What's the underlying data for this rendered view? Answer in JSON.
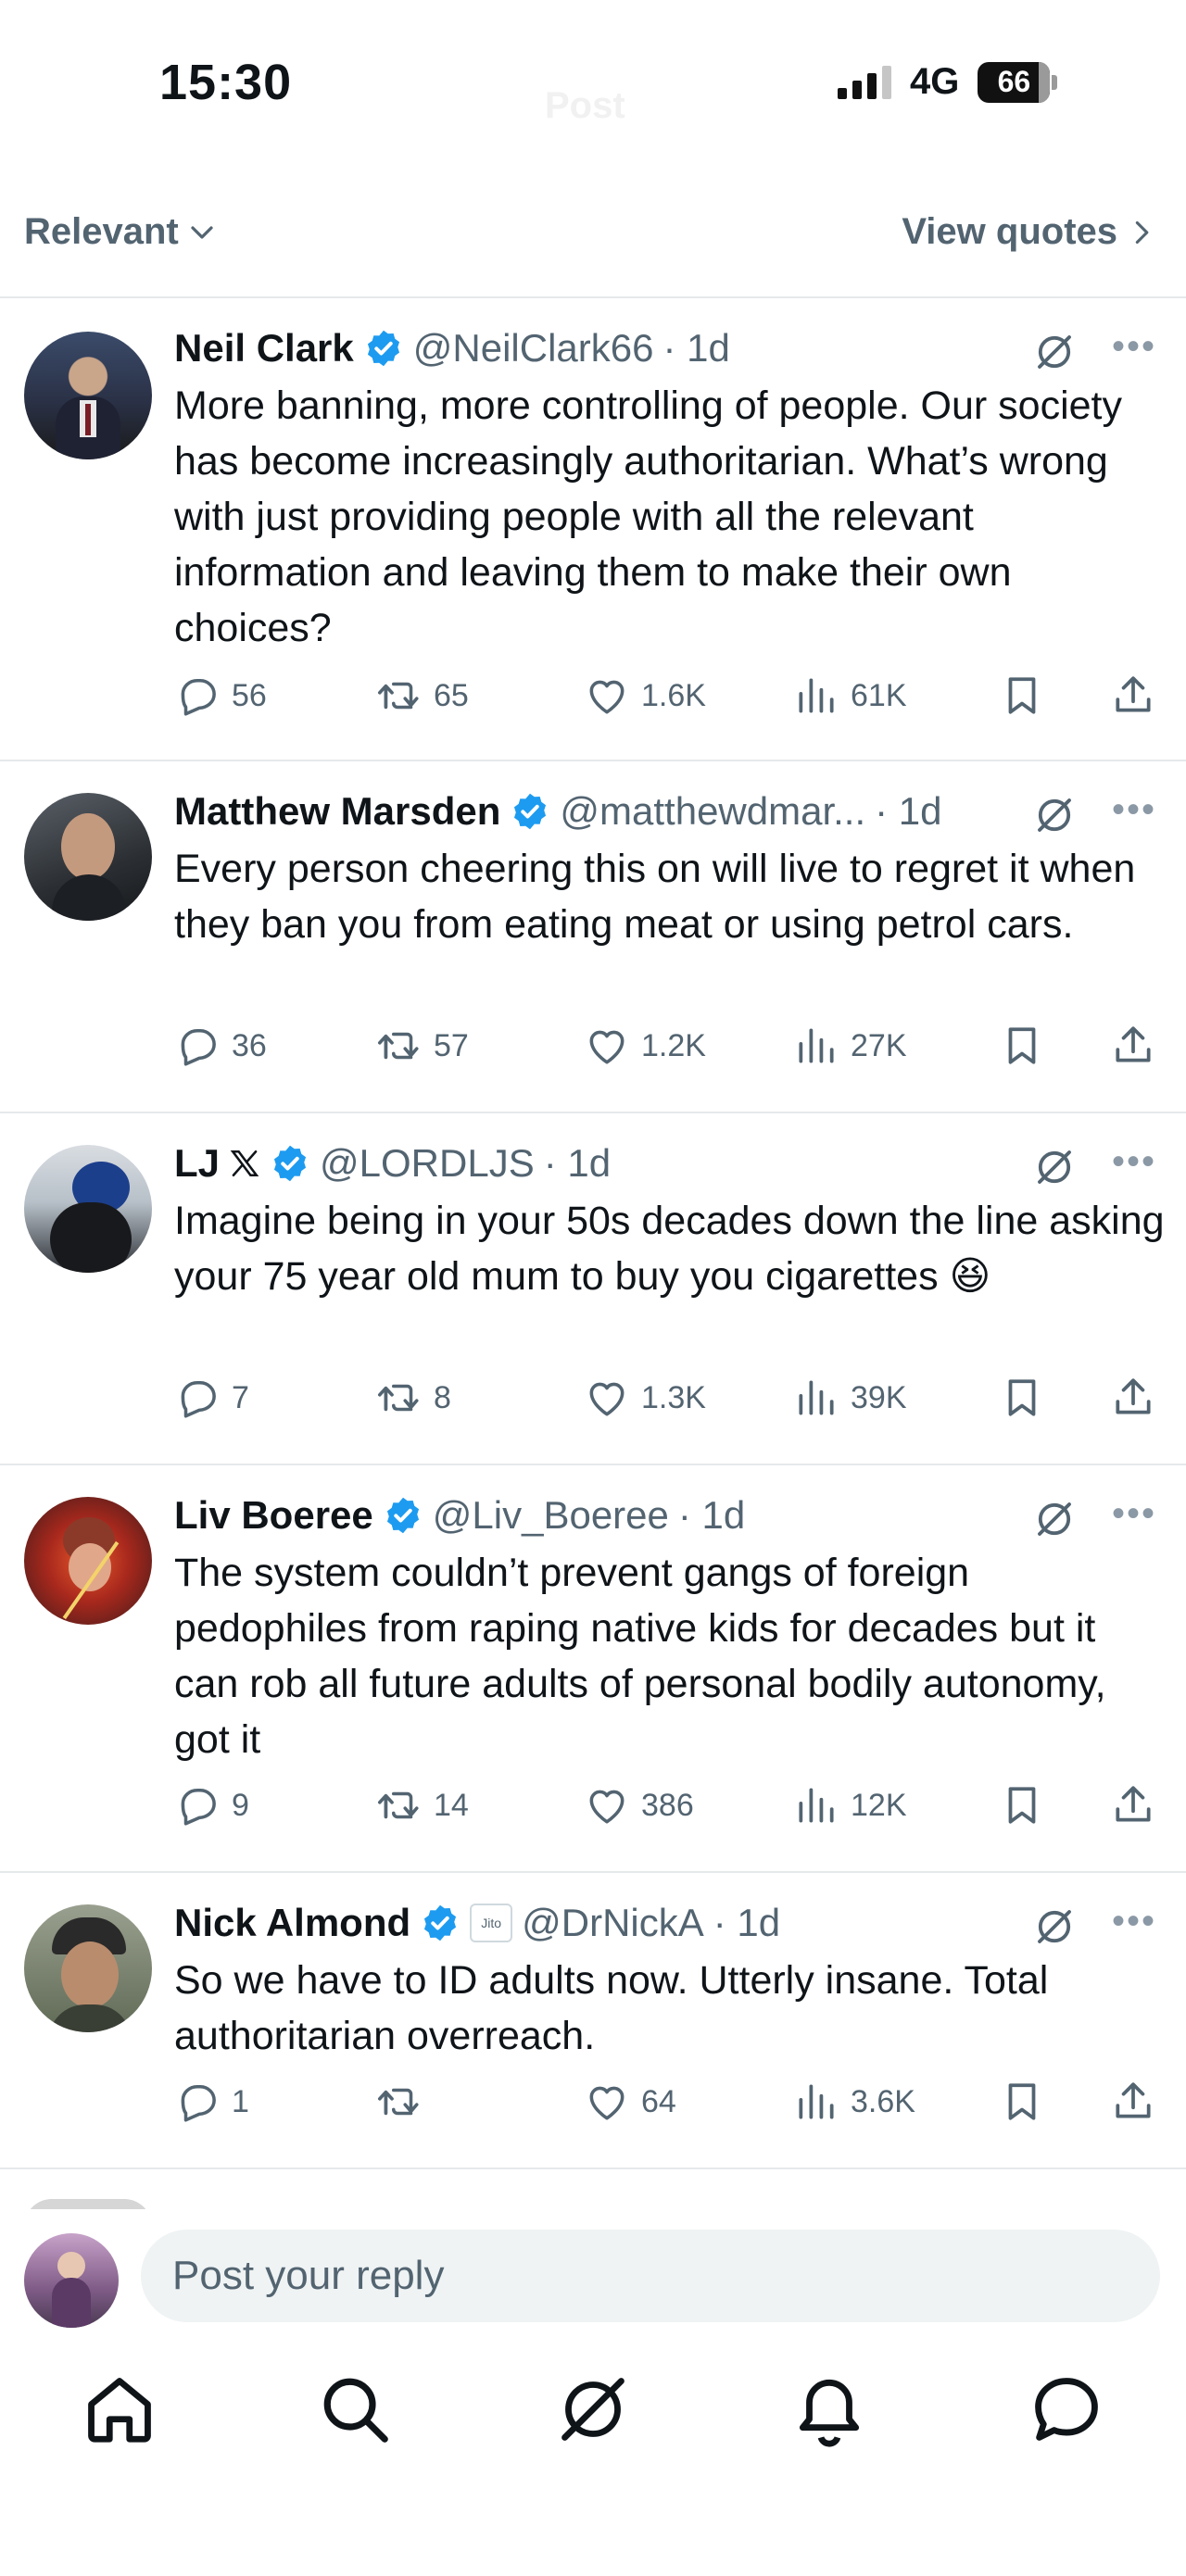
{
  "status_bar": {
    "time": "15:30",
    "network": "4G",
    "battery": "66"
  },
  "header": {
    "title": "Post"
  },
  "sort_bar": {
    "sort_label": "Relevant",
    "view_quotes_label": "View quotes"
  },
  "colors": {
    "verified": "#1d9bf0",
    "secondary": "#536471",
    "divider": "#e6e9eb"
  },
  "replies": [
    {
      "name": "Neil Clark",
      "handle": "@NeilClark66",
      "time": "· 1d",
      "text": "More banning, more controlling of people. Our society has become increasingly authoritarian. What’s wrong with just providing people with all the relevant information and leaving them to make their own choices?",
      "replies": "56",
      "reposts": "65",
      "likes": "1.6K",
      "views": "61K"
    },
    {
      "name": "Matthew Marsden",
      "handle": "@matthewdmar...",
      "time": "· 1d",
      "text": "Every person cheering this on will live to regret it when they ban you from eating meat or using petrol cars.",
      "replies": "36",
      "reposts": "57",
      "likes": "1.2K",
      "views": "27K"
    },
    {
      "name": "LJ",
      "badge_icon": "x-logo-icon",
      "handle": "@LORDLJS",
      "time": "· 1d",
      "text": "Imagine being in your 50s decades down the line asking your 75 year old mum to buy you cigarettes 😆",
      "replies": "7",
      "reposts": "8",
      "likes": "1.3K",
      "views": "39K"
    },
    {
      "name": "Liv Boeree",
      "handle": "@Liv_Boeree",
      "time": "· 1d",
      "text": "The system couldn’t prevent gangs of foreign pedophiles from raping native kids for decades but it can rob all future adults of personal bodily autonomy, got it",
      "replies": "9",
      "reposts": "14",
      "likes": "386",
      "views": "12K"
    },
    {
      "name": "Nick Almond",
      "affiliate_badge": "Jito",
      "handle": "@DrNickA",
      "time": "· 1d",
      "text": "So we have to ID adults now. Utterly insane. Total authoritarian overreach.",
      "replies": "1",
      "reposts": "",
      "likes": "64",
      "views": "3.6K"
    }
  ],
  "reply_composer": {
    "placeholder": "Post your reply"
  },
  "bottom_nav": {
    "icons": [
      "home-icon",
      "search-icon",
      "grok-icon",
      "notifications-icon",
      "messages-icon"
    ]
  }
}
